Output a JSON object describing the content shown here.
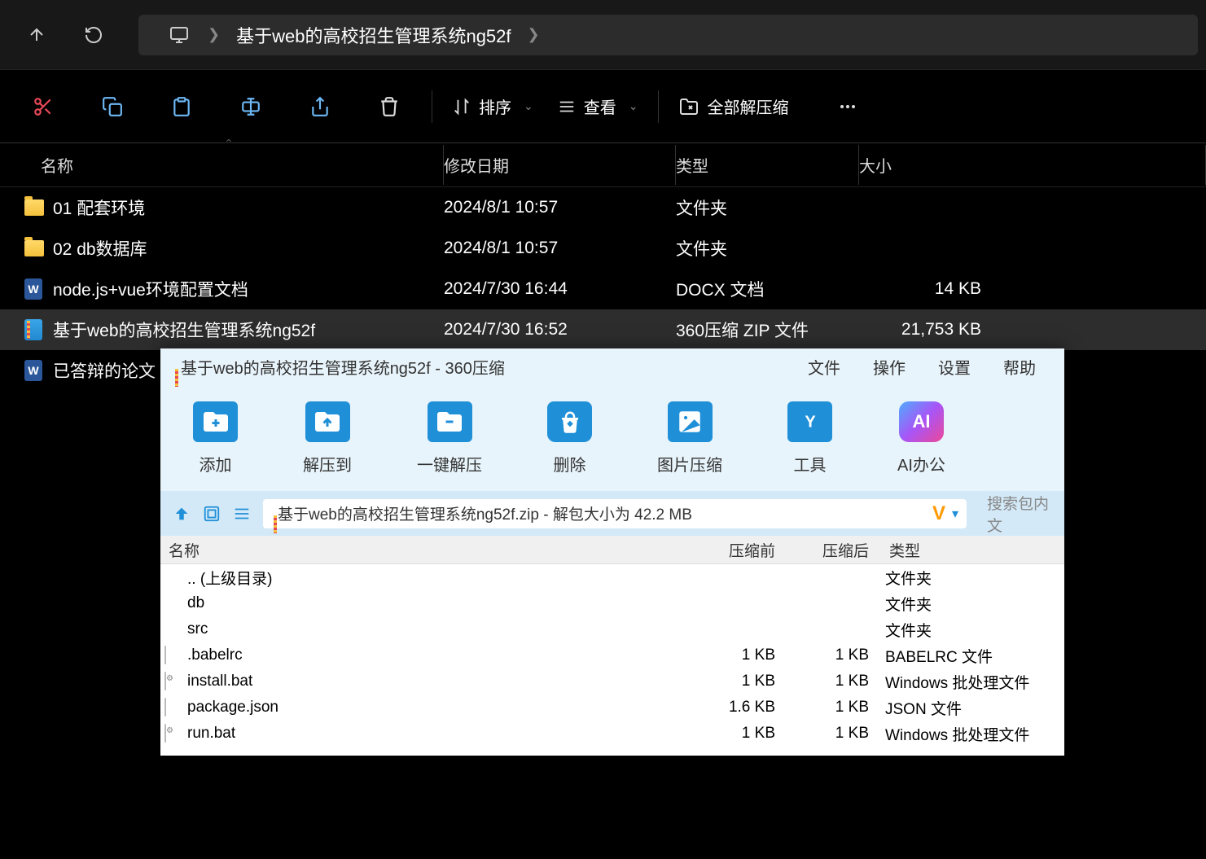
{
  "breadcrumb": {
    "current": "基于web的高校招生管理系统ng52f"
  },
  "toolbar": {
    "sort": "排序",
    "view": "查看",
    "extract_all": "全部解压缩"
  },
  "columns": {
    "name": "名称",
    "date": "修改日期",
    "type": "类型",
    "size": "大小"
  },
  "files": [
    {
      "icon": "folder",
      "name": "01 配套环境",
      "date": "2024/8/1 10:57",
      "type": "文件夹",
      "size": ""
    },
    {
      "icon": "folder",
      "name": "02 db数据库",
      "date": "2024/8/1 10:57",
      "type": "文件夹",
      "size": ""
    },
    {
      "icon": "doc",
      "name": "node.js+vue环境配置文档",
      "date": "2024/7/30 16:44",
      "type": "DOCX 文档",
      "size": "14 KB"
    },
    {
      "icon": "zip",
      "name": "基于web的高校招生管理系统ng52f",
      "date": "2024/7/30 16:52",
      "type": "360压缩 ZIP 文件",
      "size": "21,753 KB",
      "selected": true
    },
    {
      "icon": "doc",
      "name": "已答辩的论文",
      "date": "",
      "type": "",
      "size": ""
    }
  ],
  "archive": {
    "title": "基于web的高校招生管理系统ng52f - 360压缩",
    "menu": {
      "file": "文件",
      "operation": "操作",
      "settings": "设置",
      "help": "帮助"
    },
    "tools": {
      "add": "添加",
      "extract_to": "解压到",
      "one_click": "一键解压",
      "delete": "删除",
      "image_compress": "图片压缩",
      "tools": "工具",
      "ai_office": "AI办公"
    },
    "path": "基于web的高校招生管理系统ng52f.zip - 解包大小为 42.2 MB",
    "search_placeholder": "搜索包内文",
    "vip": "V",
    "columns": {
      "name": "名称",
      "before": "压缩前",
      "after": "压缩后",
      "type": "类型"
    },
    "files": [
      {
        "icon": "folder",
        "name": ".. (上级目录)",
        "before": "",
        "after": "",
        "type": "文件夹"
      },
      {
        "icon": "folder",
        "name": "db",
        "before": "",
        "after": "",
        "type": "文件夹"
      },
      {
        "icon": "folder",
        "name": "src",
        "before": "",
        "after": "",
        "type": "文件夹"
      },
      {
        "icon": "file",
        "name": ".babelrc",
        "before": "1 KB",
        "after": "1 KB",
        "type": "BABELRC 文件"
      },
      {
        "icon": "bat",
        "name": "install.bat",
        "before": "1 KB",
        "after": "1 KB",
        "type": "Windows 批处理文件"
      },
      {
        "icon": "file",
        "name": "package.json",
        "before": "1.6 KB",
        "after": "1 KB",
        "type": "JSON 文件"
      },
      {
        "icon": "bat",
        "name": "run.bat",
        "before": "1 KB",
        "after": "1 KB",
        "type": "Windows 批处理文件"
      }
    ]
  }
}
